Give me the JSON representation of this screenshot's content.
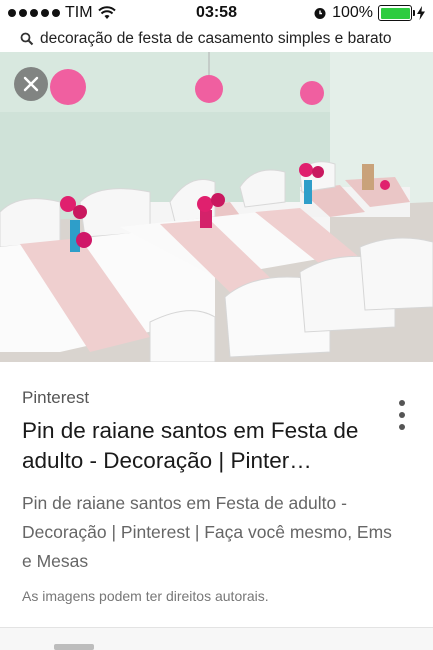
{
  "status_bar": {
    "carrier": "TIM",
    "time": "03:58",
    "battery_percent": "100%",
    "battery_level": 1.0,
    "icons": [
      "signal-dots-icon",
      "wifi-icon",
      "alarm-clock-icon",
      "battery-icon",
      "charging-bolt-icon"
    ]
  },
  "search": {
    "query": "decoração de festa de casamento simples e barato",
    "icon": "search-icon"
  },
  "image": {
    "close_icon": "close-icon",
    "description_visual": "photo"
  },
  "result": {
    "source": "Pinterest",
    "title": "Pin de raiane santos em Festa de adulto - Decoração | Pinter…",
    "description": "Pin de raiane santos em Festa de adulto - Decoração | Pinterest | Faça você mesmo, Ems e Mesas",
    "copyright": "As imagens podem ter direitos autorais.",
    "menu_icon": "more-vert-icon"
  },
  "colors": {
    "battery_fill": "#2ecc40",
    "close_button_bg": "#6e6e6e",
    "title_text": "#1a1a1a",
    "secondary_text": "#666666"
  }
}
